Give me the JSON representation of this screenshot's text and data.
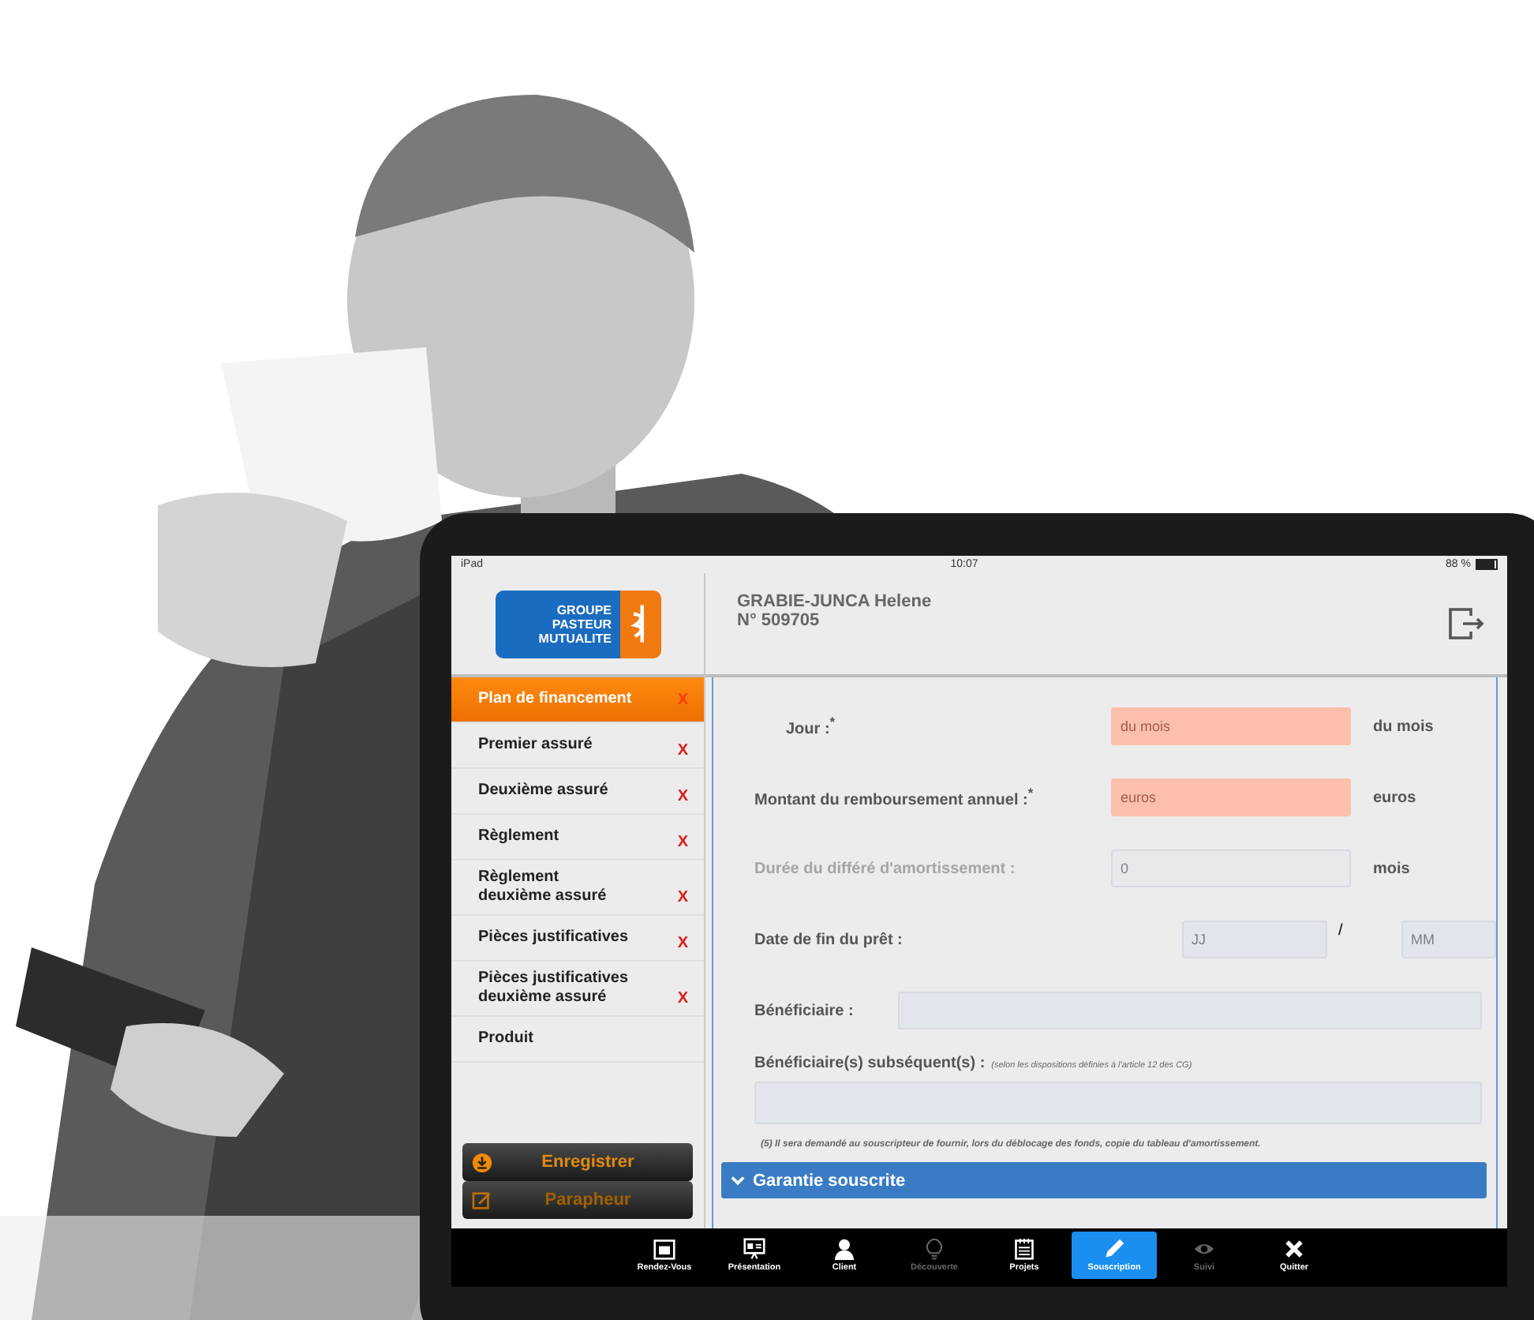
{
  "status_bar": {
    "device": "iPad",
    "time": "10:07",
    "battery": "88 %"
  },
  "logo": {
    "lines": [
      "GROUPE",
      "PASTEUR",
      "MUTUALITE"
    ]
  },
  "header": {
    "client_name": "GRABIE-JUNCA Helene",
    "client_number": "N° 509705"
  },
  "sidebar": {
    "items": [
      {
        "label": "Plan de financement",
        "selected": true,
        "mark": "X"
      },
      {
        "label": "Premier assuré",
        "selected": false,
        "mark": "X"
      },
      {
        "label": "Deuxième assuré",
        "selected": false,
        "mark": "X"
      },
      {
        "label": "Règlement",
        "selected": false,
        "mark": "X"
      },
      {
        "label": "Règlement deuxième assuré",
        "selected": false,
        "mark": "X"
      },
      {
        "label": "Pièces justificatives",
        "selected": false,
        "mark": "X"
      },
      {
        "label": "Pièces justificatives deuxième assuré",
        "selected": false,
        "mark": "X"
      },
      {
        "label": "Produit",
        "selected": false
      }
    ],
    "buttons": [
      {
        "label": "Enregistrer",
        "kind": "save"
      },
      {
        "label": "Parapheur",
        "kind": "sign"
      }
    ]
  },
  "form": {
    "rows": [
      {
        "kind": "field",
        "label": "Jour :$^{*}$",
        "placeholder": "du mois",
        "unit": "du mois",
        "error": true,
        "disabled": false,
        "indented": true
      },
      {
        "kind": "field",
        "label": "Montant du remboursement annuel :$^{*}$",
        "placeholder": "euros",
        "unit": "euros",
        "error": true,
        "disabled": false,
        "indented": false
      },
      {
        "kind": "field",
        "label": "Durée du différé d'amortissement :",
        "placeholder": "0",
        "unit": "mois",
        "error": false,
        "disabled": true,
        "indented": false
      },
      {
        "kind": "date",
        "label": "Date de fin du prêt :",
        "placeholders": [
          "JJ",
          "MM"
        ],
        "separator": "/"
      },
      {
        "kind": "inline",
        "label": "Bénéficiaire :"
      },
      {
        "kind": "block",
        "label": "Bénéficiaire(s) subséquent(s) :",
        "note": "(selon les dispositions définies à l'article 12 des CG)"
      }
    ],
    "footnote": "(5) Il sera demandé au souscripteur de fournir, lors du déblocage des fonds, copie du tableau d'amortissement.",
    "section": {
      "title": "Garantie souscrite",
      "expanded": true
    }
  },
  "tabbar": {
    "items": [
      {
        "label": "Rendez-Vous",
        "kind": "calendar",
        "selected": false,
        "disabled": false
      },
      {
        "label": "Présentation",
        "kind": "easel",
        "selected": false,
        "disabled": false
      },
      {
        "label": "Client",
        "kind": "person",
        "selected": false,
        "disabled": false
      },
      {
        "label": "Découverte",
        "kind": "bulb",
        "selected": false,
        "disabled": true
      },
      {
        "label": "Projets",
        "kind": "notepad",
        "selected": false,
        "disabled": false
      },
      {
        "label": "Souscription",
        "kind": "pencil",
        "selected": true,
        "disabled": false
      },
      {
        "label": "Suivi",
        "kind": "eye",
        "selected": false,
        "disabled": true
      },
      {
        "label": "Quitter",
        "kind": "close",
        "selected": false,
        "disabled": false
      }
    ]
  }
}
